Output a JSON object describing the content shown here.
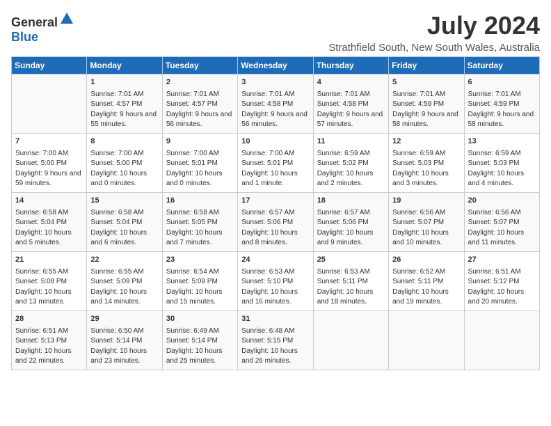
{
  "header": {
    "logo_general": "General",
    "logo_blue": "Blue",
    "title": "July 2024",
    "subtitle": "Strathfield South, New South Wales, Australia"
  },
  "days_of_week": [
    "Sunday",
    "Monday",
    "Tuesday",
    "Wednesday",
    "Thursday",
    "Friday",
    "Saturday"
  ],
  "weeks": [
    [
      {
        "day": "",
        "info": ""
      },
      {
        "day": "1",
        "info": "Sunrise: 7:01 AM\nSunset: 4:57 PM\nDaylight: 9 hours and 55 minutes."
      },
      {
        "day": "2",
        "info": "Sunrise: 7:01 AM\nSunset: 4:57 PM\nDaylight: 9 hours and 56 minutes."
      },
      {
        "day": "3",
        "info": "Sunrise: 7:01 AM\nSunset: 4:58 PM\nDaylight: 9 hours and 56 minutes."
      },
      {
        "day": "4",
        "info": "Sunrise: 7:01 AM\nSunset: 4:58 PM\nDaylight: 9 hours and 57 minutes."
      },
      {
        "day": "5",
        "info": "Sunrise: 7:01 AM\nSunset: 4:59 PM\nDaylight: 9 hours and 58 minutes."
      },
      {
        "day": "6",
        "info": "Sunrise: 7:01 AM\nSunset: 4:59 PM\nDaylight: 9 hours and 58 minutes."
      }
    ],
    [
      {
        "day": "7",
        "info": "Sunrise: 7:00 AM\nSunset: 5:00 PM\nDaylight: 9 hours and 59 minutes."
      },
      {
        "day": "8",
        "info": "Sunrise: 7:00 AM\nSunset: 5:00 PM\nDaylight: 10 hours and 0 minutes."
      },
      {
        "day": "9",
        "info": "Sunrise: 7:00 AM\nSunset: 5:01 PM\nDaylight: 10 hours and 0 minutes."
      },
      {
        "day": "10",
        "info": "Sunrise: 7:00 AM\nSunset: 5:01 PM\nDaylight: 10 hours and 1 minute."
      },
      {
        "day": "11",
        "info": "Sunrise: 6:59 AM\nSunset: 5:02 PM\nDaylight: 10 hours and 2 minutes."
      },
      {
        "day": "12",
        "info": "Sunrise: 6:59 AM\nSunset: 5:03 PM\nDaylight: 10 hours and 3 minutes."
      },
      {
        "day": "13",
        "info": "Sunrise: 6:59 AM\nSunset: 5:03 PM\nDaylight: 10 hours and 4 minutes."
      }
    ],
    [
      {
        "day": "14",
        "info": "Sunrise: 6:58 AM\nSunset: 5:04 PM\nDaylight: 10 hours and 5 minutes."
      },
      {
        "day": "15",
        "info": "Sunrise: 6:58 AM\nSunset: 5:04 PM\nDaylight: 10 hours and 6 minutes."
      },
      {
        "day": "16",
        "info": "Sunrise: 6:58 AM\nSunset: 5:05 PM\nDaylight: 10 hours and 7 minutes."
      },
      {
        "day": "17",
        "info": "Sunrise: 6:57 AM\nSunset: 5:06 PM\nDaylight: 10 hours and 8 minutes."
      },
      {
        "day": "18",
        "info": "Sunrise: 6:57 AM\nSunset: 5:06 PM\nDaylight: 10 hours and 9 minutes."
      },
      {
        "day": "19",
        "info": "Sunrise: 6:56 AM\nSunset: 5:07 PM\nDaylight: 10 hours and 10 minutes."
      },
      {
        "day": "20",
        "info": "Sunrise: 6:56 AM\nSunset: 5:07 PM\nDaylight: 10 hours and 11 minutes."
      }
    ],
    [
      {
        "day": "21",
        "info": "Sunrise: 6:55 AM\nSunset: 5:08 PM\nDaylight: 10 hours and 13 minutes."
      },
      {
        "day": "22",
        "info": "Sunrise: 6:55 AM\nSunset: 5:09 PM\nDaylight: 10 hours and 14 minutes."
      },
      {
        "day": "23",
        "info": "Sunrise: 6:54 AM\nSunset: 5:09 PM\nDaylight: 10 hours and 15 minutes."
      },
      {
        "day": "24",
        "info": "Sunrise: 6:53 AM\nSunset: 5:10 PM\nDaylight: 10 hours and 16 minutes."
      },
      {
        "day": "25",
        "info": "Sunrise: 6:53 AM\nSunset: 5:11 PM\nDaylight: 10 hours and 18 minutes."
      },
      {
        "day": "26",
        "info": "Sunrise: 6:52 AM\nSunset: 5:11 PM\nDaylight: 10 hours and 19 minutes."
      },
      {
        "day": "27",
        "info": "Sunrise: 6:51 AM\nSunset: 5:12 PM\nDaylight: 10 hours and 20 minutes."
      }
    ],
    [
      {
        "day": "28",
        "info": "Sunrise: 6:51 AM\nSunset: 5:13 PM\nDaylight: 10 hours and 22 minutes."
      },
      {
        "day": "29",
        "info": "Sunrise: 6:50 AM\nSunset: 5:14 PM\nDaylight: 10 hours and 23 minutes."
      },
      {
        "day": "30",
        "info": "Sunrise: 6:49 AM\nSunset: 5:14 PM\nDaylight: 10 hours and 25 minutes."
      },
      {
        "day": "31",
        "info": "Sunrise: 6:48 AM\nSunset: 5:15 PM\nDaylight: 10 hours and 26 minutes."
      },
      {
        "day": "",
        "info": ""
      },
      {
        "day": "",
        "info": ""
      },
      {
        "day": "",
        "info": ""
      }
    ]
  ]
}
